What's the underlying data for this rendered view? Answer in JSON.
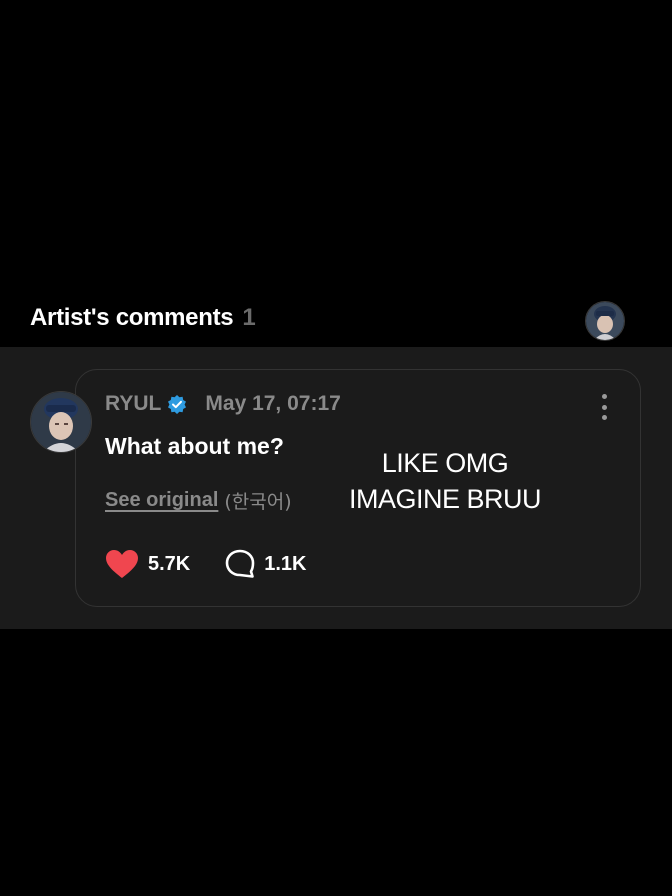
{
  "section": {
    "title": "Artist's comments",
    "count": "1"
  },
  "comment": {
    "author": "RYUL",
    "timestamp": "May 17, 07:17",
    "text": "What about me?",
    "see_original_label": "See original",
    "original_language": "(한국어)",
    "likes": "5.7K",
    "replies": "1.1K"
  },
  "overlay": {
    "line1": "LIKE OMG",
    "line2": "IMAGINE BRUU"
  },
  "icons": {
    "verified": "verified-badge-icon",
    "more": "more-vertical-icon",
    "like": "heart-icon",
    "reply": "speech-bubble-icon"
  },
  "colors": {
    "background": "#000000",
    "panel": "#1b1b1b",
    "card_border": "#333333",
    "muted_text": "#8a8a8a",
    "heart": "#f0464f",
    "verified": "#2e9be0"
  }
}
